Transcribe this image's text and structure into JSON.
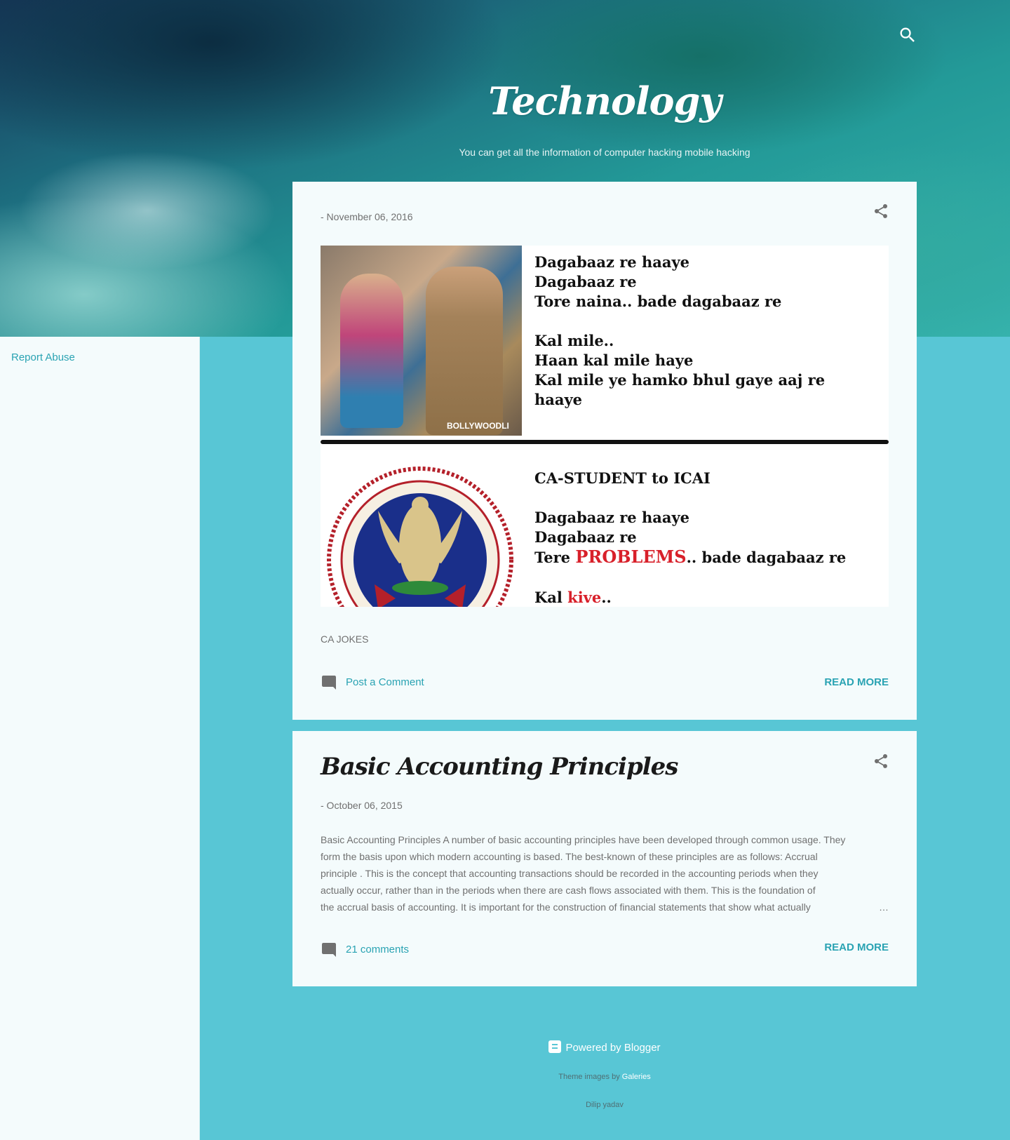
{
  "header": {
    "title": "Technology",
    "description": "You can get all the information of computer hacking mobile hacking",
    "search_icon": "search-icon"
  },
  "sidebar": {
    "report_abuse": "Report Abuse"
  },
  "posts": [
    {
      "date": "- November 06, 2016",
      "share_icon": "share-icon",
      "image": {
        "panel1_lines": [
          "Dagabaaz re haaye",
          "Dagabaaz re",
          "Tore naina.. bade dagabaaz re",
          "",
          "Kal mile..",
          "Haan kal mile haye",
          "Kal mile ye hamko bhul gaye aaj re",
          "haaye"
        ],
        "panel1_watermark": "BOLLYWOODLI",
        "panel2_heading": "CA-STUDENT to ICAI",
        "panel2_line1": "Dagabaaz re haaye",
        "panel2_line2": "Dagabaaz re",
        "panel2_line3_prefix": "Tere ",
        "panel2_line3_highlight": "PROBLEMS",
        "panel2_line3_suffix": ".. bade dagabaaz re",
        "panel2_line4_prefix": "Kal ",
        "panel2_line4_highlight": "kive",
        "panel2_line4_suffix": ".."
      },
      "snippet": "CA JOKES",
      "comments": "Post a Comment",
      "read_more": "READ MORE"
    },
    {
      "title": "Basic Accounting Principles",
      "date": "- October 06, 2015",
      "share_icon": "share-icon",
      "snippet_lines": [
        "Basic Accounting Principles A number of basic accounting principles have been developed through common usage. They",
        "form the basis upon which modern accounting is based. The best-known of these principles are as follows: Accrual",
        "principle . This is the concept that accounting transactions should be recorded in the accounting periods when they",
        "actually occur, rather than in the periods when there are cash flows associated with them. This is the foundation of",
        "the accrual basis of accounting. It is important for the construction of financial statements that show what actually"
      ],
      "ellipsis": "…",
      "comments": "21 comments",
      "read_more": "READ MORE"
    }
  ],
  "footer": {
    "powered_by": "Powered by Blogger",
    "theme_prefix": "Theme images by",
    "theme_link": "Galeries",
    "author": "Dilip yadav"
  },
  "colors": {
    "accent": "#2aa3b3",
    "background": "#58c6d5",
    "card": "#f4fbfc"
  }
}
